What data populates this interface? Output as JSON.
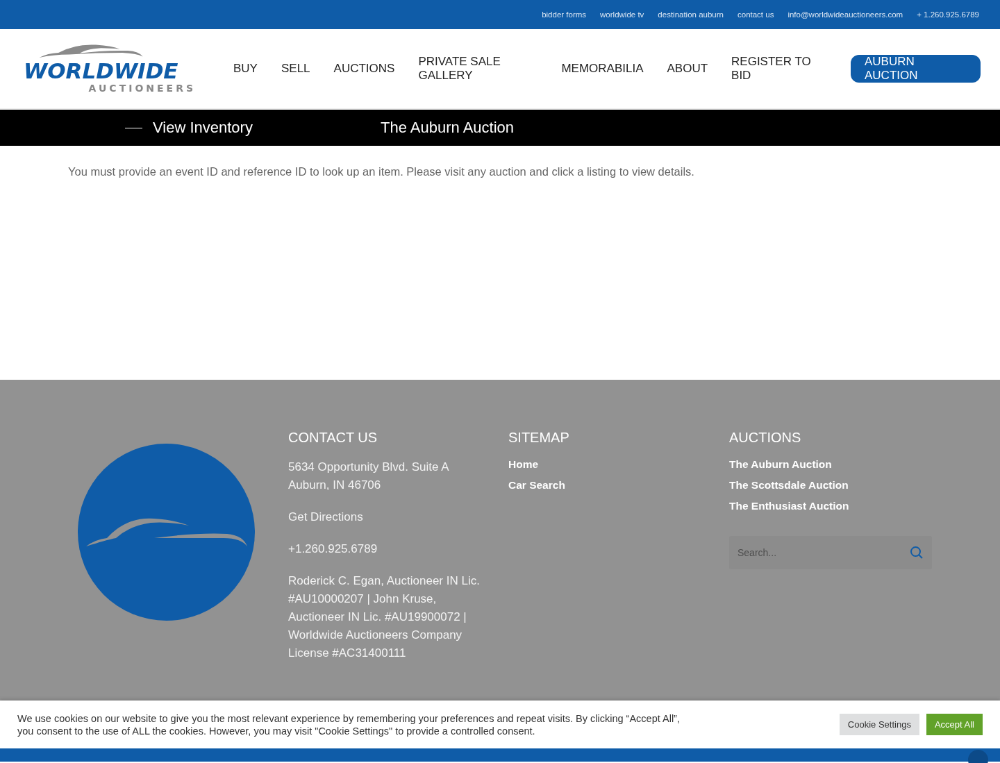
{
  "top_bar": {
    "links": [
      "bidder forms",
      "worldwide tv",
      "destination auburn",
      "contact us",
      "info@worldwideauctioneers.com",
      "+ 1.260.925.6789"
    ]
  },
  "header": {
    "logo": {
      "name": "WORLDWIDE",
      "subtitle": "AUCTIONEERS"
    },
    "nav": [
      {
        "label": "BUY",
        "kind": "link"
      },
      {
        "label": "SELL",
        "kind": "link"
      },
      {
        "label": "AUCTIONS",
        "kind": "link"
      },
      {
        "label": "PRIVATE SALE GALLERY",
        "kind": "link"
      },
      {
        "label": "MEMORABILIA",
        "kind": "link"
      },
      {
        "label": "ABOUT",
        "kind": "link"
      },
      {
        "label": "REGISTER TO BID",
        "kind": "link"
      },
      {
        "label": "AUBURN AUCTION",
        "kind": "button"
      }
    ]
  },
  "breadcrumb_bar": {
    "back_link": "View Inventory",
    "title": "The Auburn Auction"
  },
  "message": "You must provide an event ID and reference ID to look up an item. Please visit any auction and click a listing to view details.",
  "footer": {
    "contact": {
      "heading": "CONTACT US",
      "address": "5634 Opportunity Blvd. Suite A\nAuburn, IN 46706",
      "directions": "Get Directions",
      "phone": "+1.260.925.6789",
      "license": "Roderick C. Egan, Auctioneer IN Lic. #AU10000207 | John Kruse, Auctioneer IN Lic. #AU19900072 | Worldwide Auctioneers Company License #AC31400111"
    },
    "sitemap": {
      "heading": "SITEMAP",
      "links": [
        "Home",
        "Car Search"
      ]
    },
    "auctions": {
      "heading": "AUCTIONS",
      "links": [
        "The Auburn Auction",
        "The Scottsdale Auction",
        "The Enthusiast Auction"
      ],
      "search": {
        "placeholder": "Search..."
      }
    }
  },
  "cookie_banner": {
    "text": "We use cookies on our website to give you the most relevant experience by remembering your preferences and repeat visits. By clicking “Accept All”, you consent to the use of ALL the cookies. However, you may visit \"Cookie Settings\" to provide a controlled consent.",
    "buttons": [
      "Cookie Settings",
      "Accept All"
    ]
  }
}
